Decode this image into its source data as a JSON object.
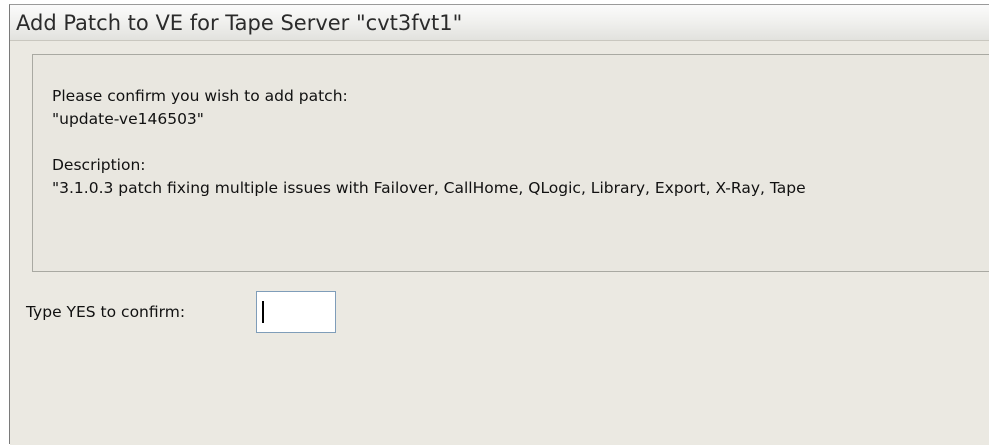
{
  "dialog": {
    "title": "Add Patch to VE for Tape Server \"cvt3fvt1\""
  },
  "message": {
    "confirm_prompt": "Please confirm you wish to add patch:",
    "patch_name": "\"update-ve146503\"",
    "description_label": "Description:",
    "description_text": "\"3.1.0.3 patch fixing multiple issues with Failover, CallHome, QLogic, Library, Export, X-Ray, Tape"
  },
  "confirm": {
    "label": "Type YES to confirm:",
    "value": ""
  }
}
